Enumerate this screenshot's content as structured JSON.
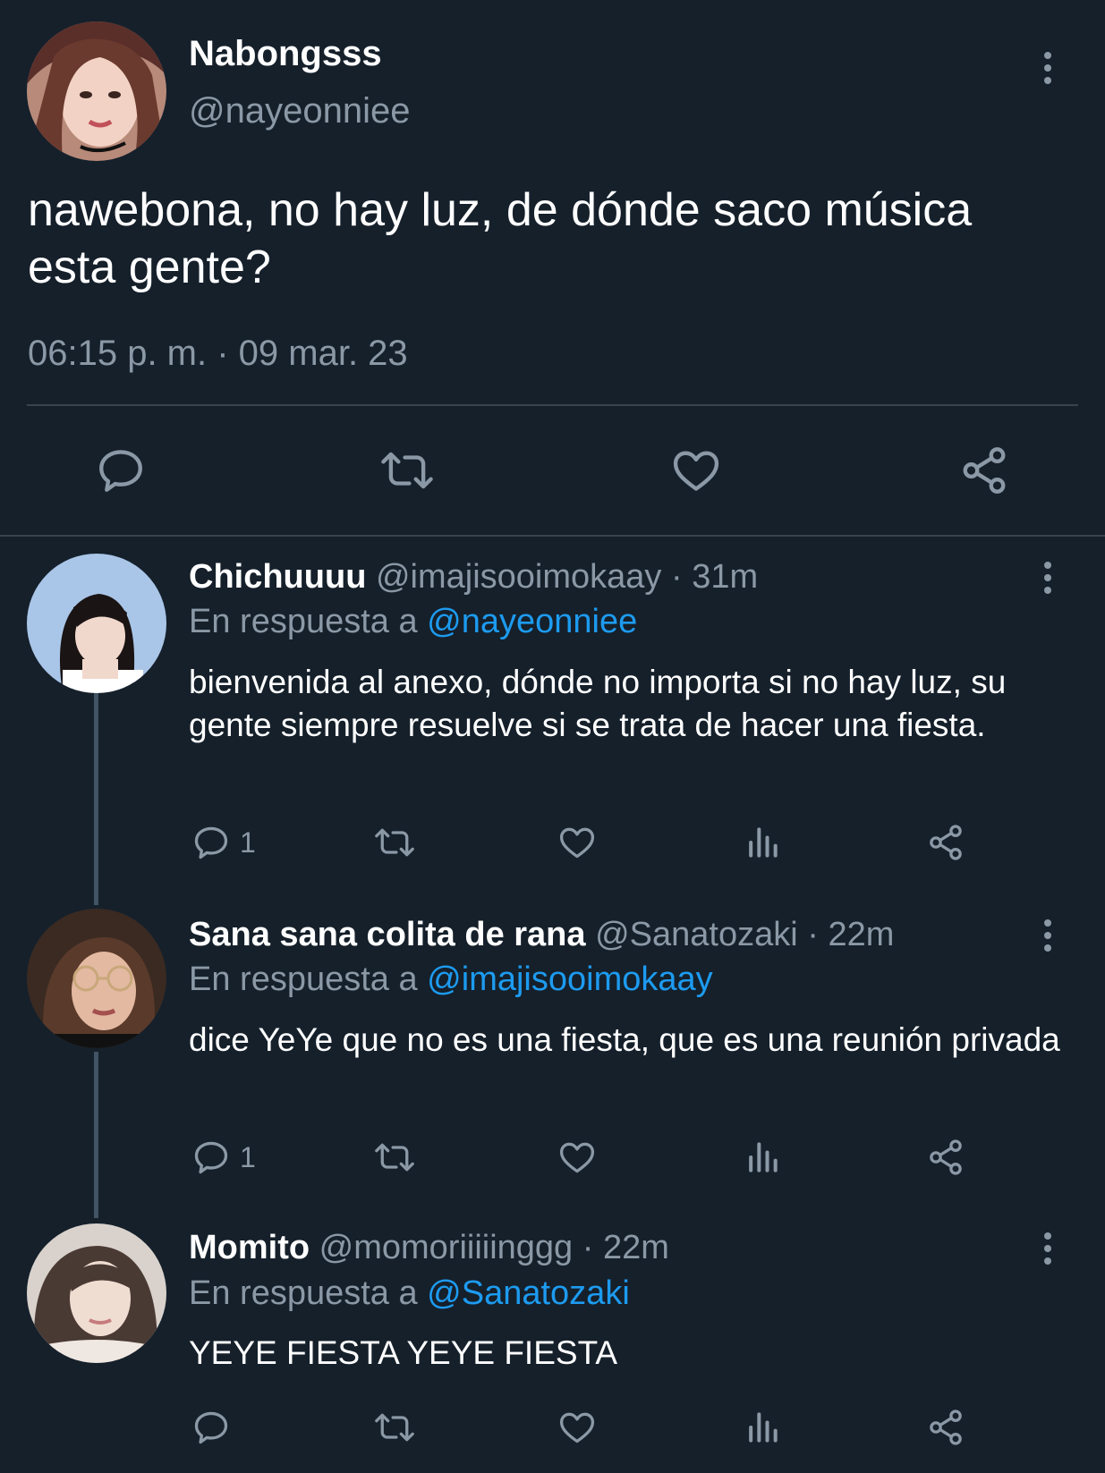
{
  "colors": {
    "background": "#15202b",
    "text": "#ffffff",
    "muted": "#8b98a5",
    "accent": "#1d9bf0",
    "divider": "#38444d"
  },
  "main_tweet": {
    "display_name": "Nabongsss",
    "handle": "@nayeonniee",
    "text": "nawebona, no hay luz, de dónde saco música esta gente?",
    "timestamp": "06:15 p. m. · 09 mar. 23",
    "actions": [
      "reply-icon",
      "retweet-icon",
      "like-icon",
      "share-icon"
    ]
  },
  "replies": [
    {
      "display_name": "Chichuuuu",
      "meta": "@imajisooimokaay · 31m",
      "reply_prefix": "En respuesta a ",
      "reply_to": "@nayeonniee",
      "text": "bienvenida al anexo, dónde no importa si no hay luz, su gente siempre resuelve  si se trata de hacer una fiesta.",
      "reply_count": "1"
    },
    {
      "display_name": "Sana sana colita de rana",
      "meta": "@Sanatozaki · 22m",
      "reply_prefix": "En respuesta a ",
      "reply_to": "@imajisooimokaay",
      "text": "dice YeYe que no es una fiesta, que es una reunión privada",
      "reply_count": "1"
    },
    {
      "display_name": "Momito",
      "meta": "@momoriiiiinggg · 22m",
      "reply_prefix": "En respuesta a ",
      "reply_to": "@Sanatozaki",
      "text": "YEYE FIESTA YEYE FIESTA",
      "reply_count": ""
    }
  ]
}
